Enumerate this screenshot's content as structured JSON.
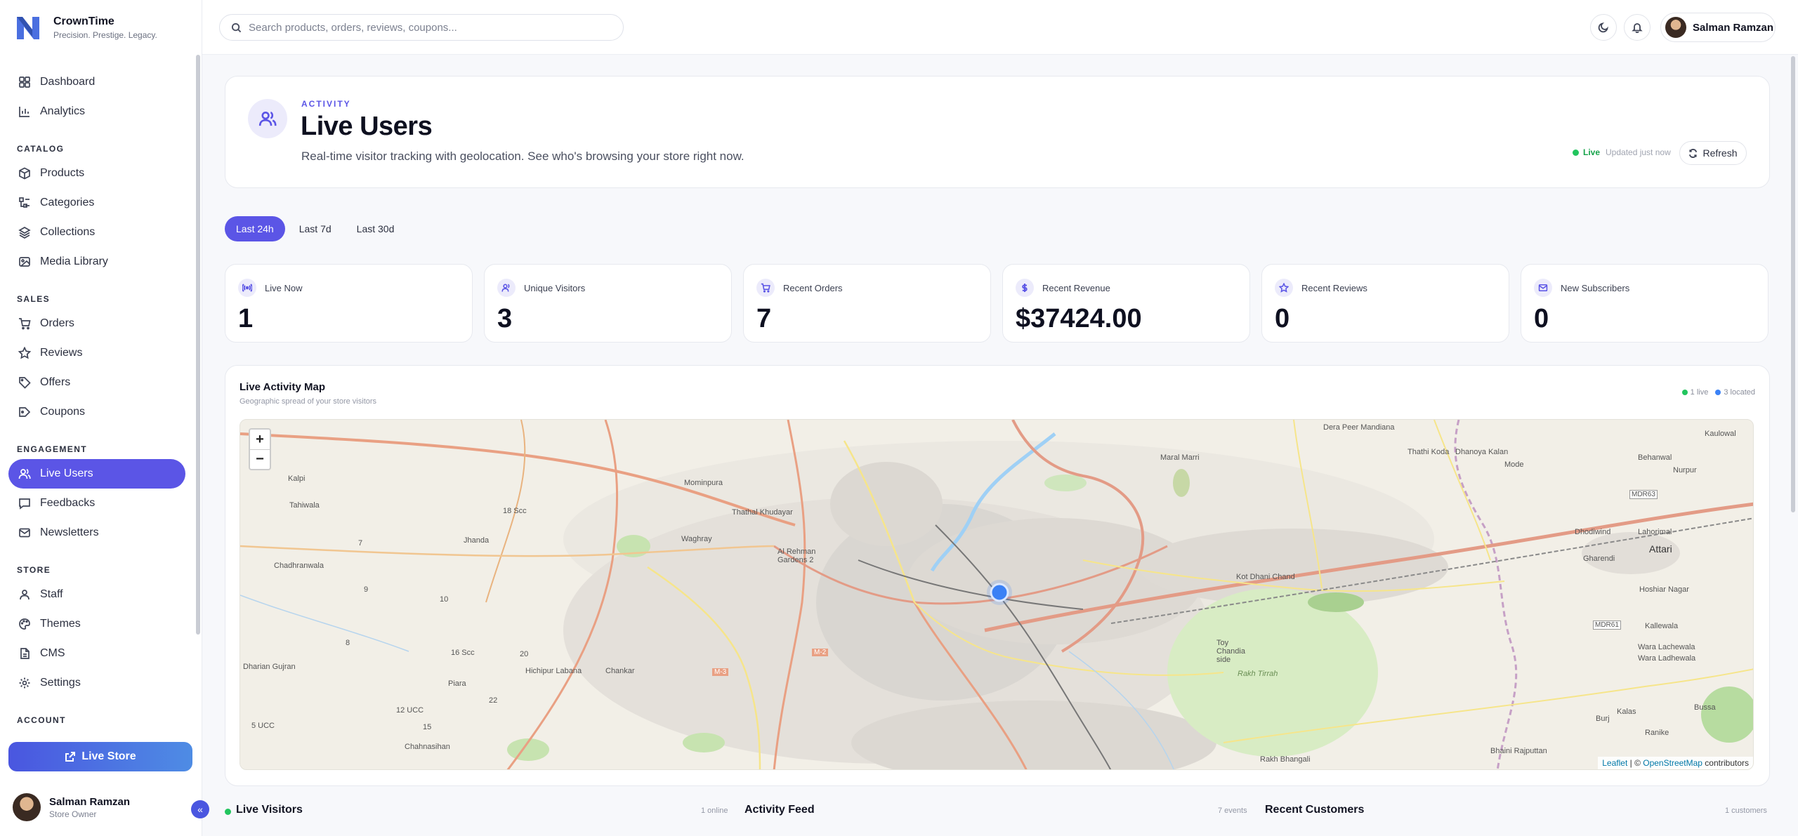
{
  "brand": {
    "name": "CrownTime",
    "tagline": "Precision. Prestige. Legacy."
  },
  "sidebar": {
    "top_items": [
      {
        "label": "Dashboard",
        "icon": "grid-icon"
      },
      {
        "label": "Analytics",
        "icon": "chart-icon"
      }
    ],
    "sections": [
      {
        "title": "CATALOG",
        "items": [
          {
            "label": "Products",
            "icon": "package-icon"
          },
          {
            "label": "Categories",
            "icon": "category-icon"
          },
          {
            "label": "Collections",
            "icon": "layers-icon"
          },
          {
            "label": "Media Library",
            "icon": "image-icon"
          }
        ]
      },
      {
        "title": "SALES",
        "items": [
          {
            "label": "Orders",
            "icon": "cart-icon"
          },
          {
            "label": "Reviews",
            "icon": "star-icon"
          },
          {
            "label": "Offers",
            "icon": "tag-icon"
          },
          {
            "label": "Coupons",
            "icon": "ticket-icon"
          }
        ]
      },
      {
        "title": "ENGAGEMENT",
        "items": [
          {
            "label": "Live Users",
            "icon": "users-icon",
            "active": true
          },
          {
            "label": "Feedbacks",
            "icon": "message-icon"
          },
          {
            "label": "Newsletters",
            "icon": "mail-icon"
          }
        ]
      },
      {
        "title": "STORE",
        "items": [
          {
            "label": "Staff",
            "icon": "user-icon"
          },
          {
            "label": "Themes",
            "icon": "palette-icon"
          },
          {
            "label": "CMS",
            "icon": "file-icon"
          },
          {
            "label": "Settings",
            "icon": "gear-icon"
          }
        ]
      },
      {
        "title": "ACCOUNT",
        "items": []
      }
    ],
    "live_store_label": "Live Store",
    "user": {
      "name": "Salman Ramzan",
      "role": "Store Owner"
    },
    "collapse_label": "«"
  },
  "topbar": {
    "search_placeholder": "Search products, orders, reviews, coupons...",
    "user_name": "Salman Ramzan"
  },
  "header": {
    "eyebrow": "ACTIVITY",
    "title": "Live Users",
    "subtitle": "Real-time visitor tracking with geolocation. See who's browsing your store right now.",
    "live_label": "Live",
    "updated": "Updated just now",
    "refresh_label": "Refresh"
  },
  "range_tabs": [
    {
      "label": "Last 24h",
      "active": true
    },
    {
      "label": "Last 7d",
      "active": false
    },
    {
      "label": "Last 30d",
      "active": false
    }
  ],
  "stats": [
    {
      "label": "Live Now",
      "value": "1",
      "icon": "broadcast-icon"
    },
    {
      "label": "Unique Visitors",
      "value": "3",
      "icon": "users-icon"
    },
    {
      "label": "Recent Orders",
      "value": "7",
      "icon": "cart-icon"
    },
    {
      "label": "Recent Revenue",
      "value": "$37424.00",
      "icon": "dollar-icon"
    },
    {
      "label": "Recent Reviews",
      "value": "0",
      "icon": "star-icon"
    },
    {
      "label": "New Subscribers",
      "value": "0",
      "icon": "mail-icon"
    }
  ],
  "map": {
    "title": "Live Activity Map",
    "subtitle": "Geographic spread of your store visitors",
    "legend_live": "1 live",
    "legend_located": "3 located",
    "zoom_in": "+",
    "zoom_out": "−",
    "attribution_leaflet": "Leaflet",
    "attribution_sep": " | © ",
    "attribution_osm": "OpenStreetMap",
    "attribution_tail": " contributors",
    "places": [
      "Dera Peer Mandiana",
      "Thathi Koda",
      "Dhanoya Kalan",
      "Kaulowal",
      "Behanwal",
      "Mode",
      "Nurpur",
      "Maral Marri",
      "Mominpura",
      "Thathal Khudayar",
      "Al Rehman Gardens 2",
      "Waghray",
      "Tahiwala",
      "Kalpi",
      "Chadhranwala",
      "Jhanda",
      "Chankar",
      "Piara",
      "Chahnasihan",
      "Hichipur Labana",
      "Dharian Gujran",
      "Kot Dhani Chand",
      "Toy Chandia side",
      "Rakh Tirrah",
      "Rakh Bhangali",
      "Bhaini Rajputtan",
      "Attari",
      "Dhodiwind",
      "Lahorimal",
      "Gharendi",
      "Hoshiar Nagar",
      "Kallewala",
      "Wara Lachewala",
      "Wara Ladhewala",
      "Kalas",
      "Bussa",
      "Burj",
      "Ranike",
      "16 Scc",
      "18 Scc",
      "10",
      "12 UCC",
      "15",
      "22",
      "20",
      "5 UCC",
      "7",
      "9",
      "8",
      "MDR63",
      "MDR61",
      "M-2",
      "M-3"
    ]
  },
  "bottom": {
    "visitors_title": "Live Visitors",
    "visitors_meta": "1 online",
    "feed_title": "Activity Feed",
    "feed_meta": "7 events",
    "customers_title": "Recent Customers",
    "customers_meta": "1 customers"
  },
  "colors": {
    "accent": "#5b55e6",
    "live": "#22c55e",
    "located": "#3b82f6"
  }
}
